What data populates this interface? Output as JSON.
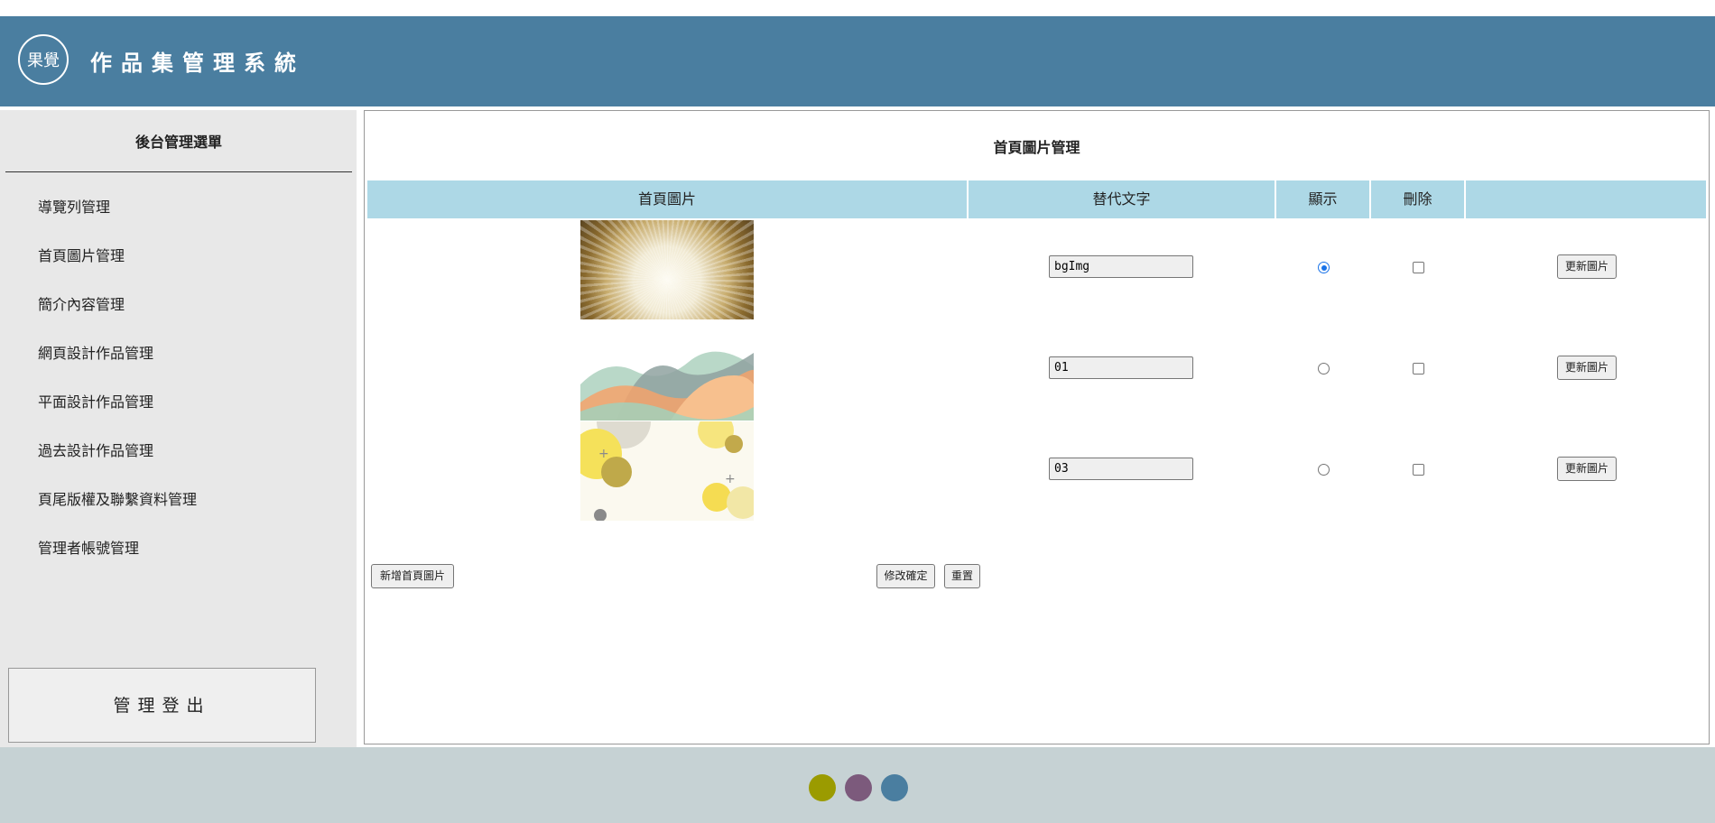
{
  "header": {
    "title": "作品集管理系統",
    "logo_glyph": "果覺"
  },
  "sidebar": {
    "title": "後台管理選單",
    "items": [
      {
        "label": "導覽列管理"
      },
      {
        "label": "首頁圖片管理"
      },
      {
        "label": "簡介內容管理"
      },
      {
        "label": "網頁設計作品管理"
      },
      {
        "label": "平面設計作品管理"
      },
      {
        "label": "過去設計作品管理"
      },
      {
        "label": "頁尾版權及聯繫資料管理"
      },
      {
        "label": "管理者帳號管理"
      }
    ],
    "logout_label": "管理登出"
  },
  "main": {
    "title": "首頁圖片管理",
    "columns": [
      "首頁圖片",
      "替代文字",
      "顯示",
      "刪除",
      ""
    ],
    "rows": [
      {
        "alt": "bgImg",
        "shown": true,
        "delete": false,
        "update_label": "更新圖片"
      },
      {
        "alt": "01",
        "shown": false,
        "delete": false,
        "update_label": "更新圖片"
      },
      {
        "alt": "03",
        "shown": false,
        "delete": false,
        "update_label": "更新圖片"
      }
    ],
    "add_label": "新增首頁圖片",
    "confirm_label": "修改確定",
    "reset_label": "重置"
  },
  "footer": {
    "dot_colors": [
      "#9b9b00",
      "#7c5a7c",
      "#4a7ea0"
    ]
  },
  "colors": {
    "header_bg": "#4a7ea0",
    "table_header_bg": "#add8e6",
    "sidebar_bg": "#e8e8e8",
    "footer_bg": "#c6d2d4"
  }
}
